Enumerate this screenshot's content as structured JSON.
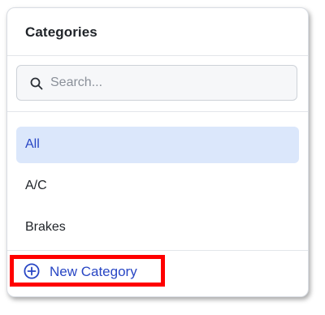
{
  "panel": {
    "title": "Categories"
  },
  "search": {
    "placeholder": "Search...",
    "value": "",
    "icon": "search-icon"
  },
  "list": {
    "items": [
      {
        "label": "All",
        "selected": true
      },
      {
        "label": "A/C",
        "selected": false
      },
      {
        "label": "Brakes",
        "selected": false
      }
    ]
  },
  "footer": {
    "new_category_label": "New Category",
    "icon": "plus-circle-icon"
  },
  "colors": {
    "accent": "#2846c4",
    "selected_bg": "#dbe7fb",
    "highlight": "#ff0000"
  }
}
